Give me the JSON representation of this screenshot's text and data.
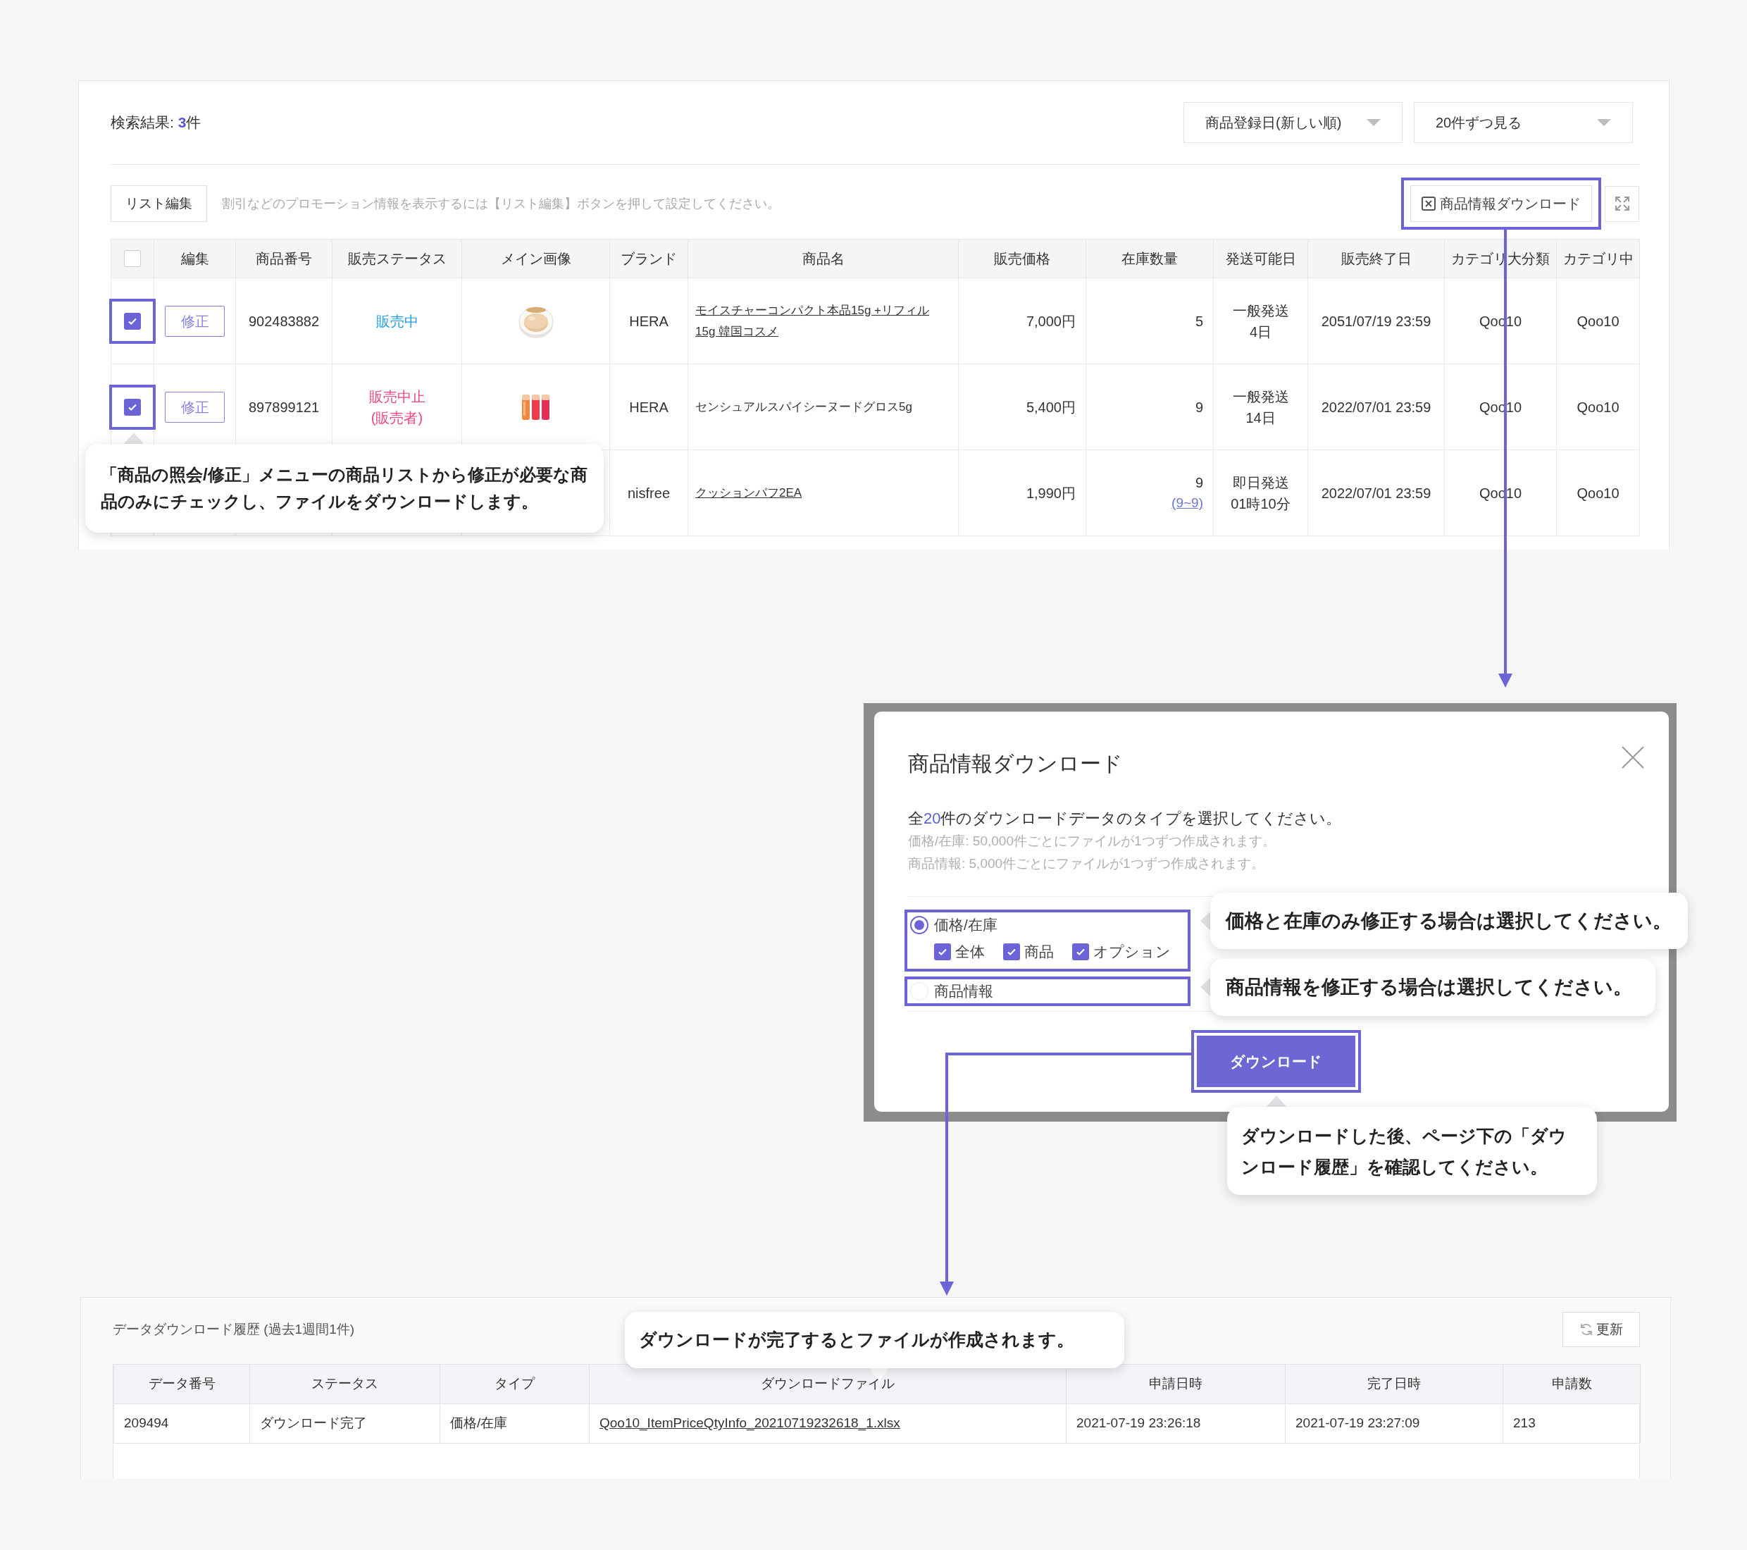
{
  "search": {
    "result_prefix": "検索結果: ",
    "result_count": "3",
    "result_suffix": "件",
    "sort_select": "商品登録日(新しい順)",
    "page_size_select": "20件ずつ見る"
  },
  "toolbar": {
    "list_edit_button": "リスト編集",
    "hint": "割引などのプロモーション情報を表示するには【リスト編集】ボタンを押して設定してください。",
    "download_button": {
      "label": "商品情報ダウンロード",
      "highlighted": true
    }
  },
  "products": {
    "select_all_checked": false,
    "columns": [
      "編集",
      "商品番号",
      "販売ステータス",
      "メイン画像",
      "ブランド",
      "商品名",
      "販売価格",
      "在庫数量",
      "発送可能日",
      "販売終了日",
      "カテゴリ大分類",
      "カテゴリ中"
    ],
    "rows": [
      {
        "checked": true,
        "highlighted": true,
        "edit_button": "修正",
        "product_no": "902483882",
        "status": {
          "text": "販売中",
          "kind": "on_sale"
        },
        "brand": "HERA",
        "name": "モイスチャーコンパクト本品15g +リフィル\n15g 韓国コスメ",
        "name_is_link": true,
        "price": "7,000円",
        "stock": "5",
        "shipping": "一般発送\n4日",
        "end_date": "2051/07/19 23:59",
        "category_large": "Qoo10",
        "category_mid": "Qoo10"
      },
      {
        "checked": true,
        "highlighted": true,
        "edit_button": "修正",
        "product_no": "897899121",
        "status": {
          "text": "販売中止\n(販売者)",
          "kind": "stopped"
        },
        "brand": "HERA",
        "name": "センシュアルスパイシーヌードグロス5g",
        "name_is_link": false,
        "price": "5,400円",
        "stock": "9",
        "shipping": "一般発送\n14日",
        "end_date": "2022/07/01 23:59",
        "category_large": "Qoo10",
        "category_mid": "Qoo10"
      },
      {
        "brand": "nisfree",
        "name": "クッションパフ2EA",
        "name_is_link": true,
        "price": "1,990円",
        "stock": "9",
        "stock_range": "(9~9)",
        "shipping": "即日発送\n01時10分",
        "end_date": "2022/07/01 23:59",
        "category_large": "Qoo10",
        "category_mid": "Qoo10"
      }
    ]
  },
  "download_dialog": {
    "title": "商品情報ダウンロード",
    "summary_prefix": "全",
    "summary_count": "20",
    "summary_suffix": "件のダウンロードデータのタイプを選択してください。",
    "notes": [
      "価格/在庫: 50,000件ごとにファイルが1つずつ作成されます。",
      "商品情報: 5,000件ごとにファイルが1つずつ作成されます。"
    ],
    "options": [
      {
        "label": "価格/在庫",
        "selected": true,
        "highlighted": true,
        "sub_options": [
          {
            "label": "全体",
            "checked": true
          },
          {
            "label": "商品",
            "checked": true
          },
          {
            "label": "オプション",
            "checked": true
          }
        ]
      },
      {
        "label": "商品情報",
        "selected": false,
        "highlighted": true
      }
    ],
    "download_button": {
      "label": "ダウンロード",
      "highlighted": true
    }
  },
  "history": {
    "title": "データダウンロード履歴 (過去1週間1件)",
    "refresh_button": "更新",
    "columns": [
      "データ番号",
      "ステータス",
      "タイプ",
      "ダウンロードファイル",
      "申請日時",
      "完了日時",
      "申請数"
    ],
    "rows": [
      {
        "data_no": "209494",
        "status": "ダウンロード完了",
        "type": "価格/在庫",
        "file": "Qoo10_ItemPriceQtyInfo_20210719232618_1.xlsx",
        "requested_at": "2021-07-19 23:26:18",
        "completed_at": "2021-07-19 23:27:09",
        "count": "213"
      }
    ]
  },
  "callouts": [
    "「商品の照会/修正」メニューの商品リストから修正が必要な商品のみにチェックし、ファイルをダウンロードします。",
    "価格と在庫のみ修正する場合は選択してください。",
    "商品情報を修正する場合は選択してください。",
    "ダウンロードした後、ページ下の「ダウンロード履歴」を確認してください。",
    "ダウンロードが完了するとファイルが作成されます。"
  ]
}
